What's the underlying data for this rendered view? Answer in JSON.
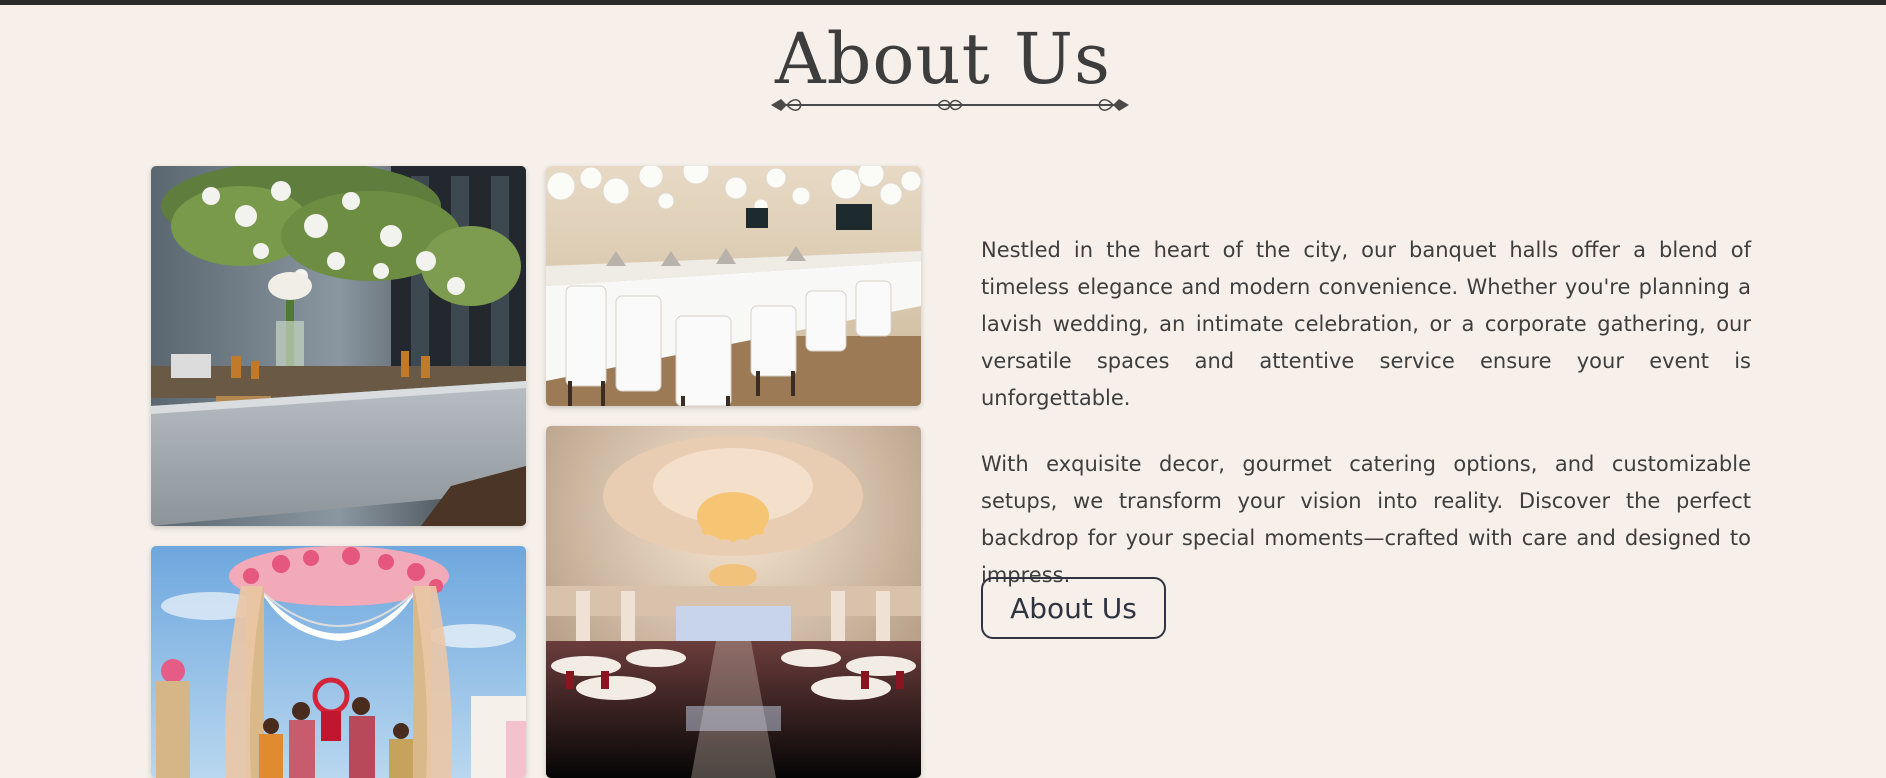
{
  "about": {
    "title": "About Us",
    "paragraphs": [
      "Nestled in the heart of the city, our banquet halls offer a blend of timeless elegance and modern convenience. Whether you're planning a lavish wedding, an intimate celebration, or a corporate gathering, our versatile spaces and attentive service ensure your event is unforgettable.",
      "With exquisite decor, gourmet catering options, and customizable setups, we transform your vision into reality. Discover the perfect backdrop for your special moments—crafted with care and designed to impress."
    ],
    "button_label": "About Us"
  },
  "gallery": [
    {
      "name": "buffet-photo",
      "subject": "floral buffet counter"
    },
    {
      "name": "tables-photo",
      "subject": "banquet tables with white balloons"
    },
    {
      "name": "mandap-photo",
      "subject": "wedding mandap ceremony"
    },
    {
      "name": "ballroom-photo",
      "subject": "ballroom with chandeliers"
    }
  ],
  "colors": {
    "background": "#f7f0ea",
    "text": "#3e3e3e",
    "button_border": "#2f3440"
  }
}
